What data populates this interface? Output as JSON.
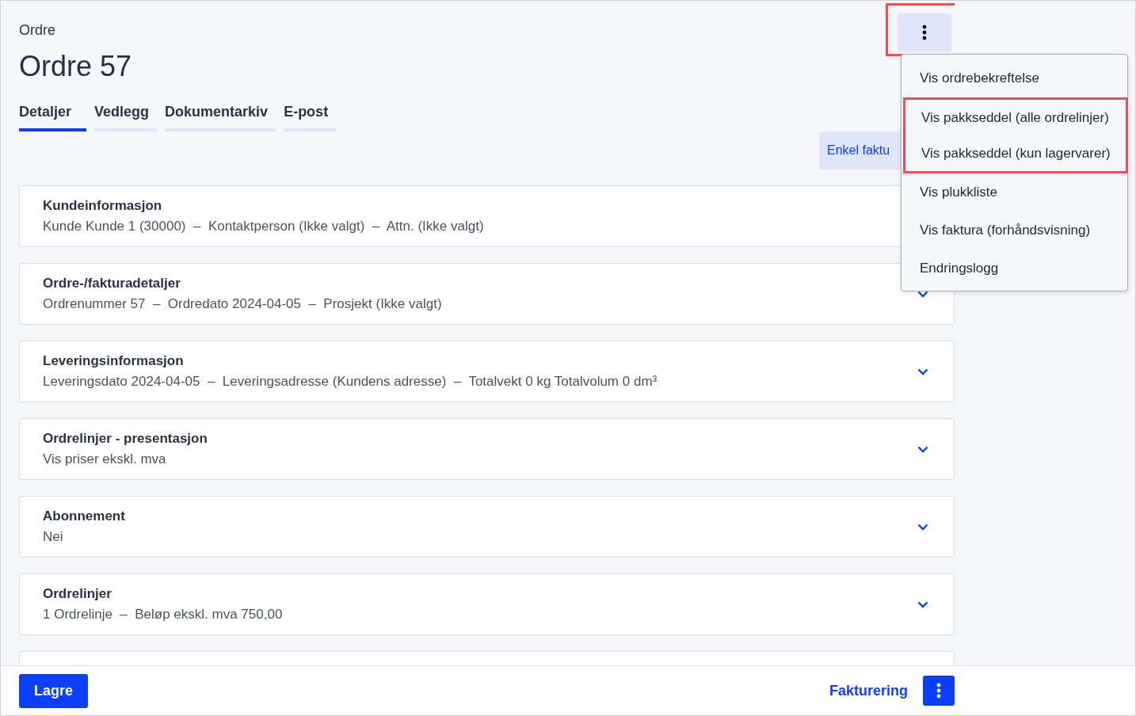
{
  "breadcrumb": "Ordre",
  "title": "Ordre 57",
  "tabs": [
    {
      "label": "Detaljer",
      "selected": true
    },
    {
      "label": "Vedlegg",
      "selected": false
    },
    {
      "label": "Dokumentarkiv",
      "selected": false
    },
    {
      "label": "E-post",
      "selected": false
    }
  ],
  "more_button": {
    "highlighted": true
  },
  "action_button": "Enkel faktu",
  "menu": [
    {
      "label": "Vis ordrebekreftelse",
      "highlighted": false
    },
    {
      "label": "Vis pakkseddel (alle ordrelinjer)",
      "highlighted": true
    },
    {
      "label": "Vis pakkseddel (kun lagervarer)",
      "highlighted": true
    },
    {
      "label": "Vis plukkliste",
      "highlighted": false
    },
    {
      "label": "Vis faktura (forhåndsvisning)",
      "highlighted": false
    },
    {
      "label": "Endringslogg",
      "highlighted": false
    }
  ],
  "sections": [
    {
      "title": "Kundeinformasjon",
      "summary": "Kunde Kunde 1 (30000)  –  Kontaktperson (Ikke valgt)  –  Attn. (Ikke valgt)",
      "chevron": false
    },
    {
      "title": "Ordre-/fakturadetaljer",
      "summary": "Ordrenummer 57  –  Ordredato 2024-04-05  –  Prosjekt (Ikke valgt)",
      "chevron": true
    },
    {
      "title": "Leveringsinformasjon",
      "summary": "Leveringsdato 2024-04-05  –  Leveringsadresse (Kundens adresse)  –  Totalvekt 0 kg Totalvolum 0 dm³",
      "chevron": true
    },
    {
      "title": "Ordrelinjer - presentasjon",
      "summary": "Vis priser ekskl. mva",
      "chevron": true
    },
    {
      "title": "Abonnement",
      "summary": "Nei",
      "chevron": true
    },
    {
      "title": "Ordrelinjer",
      "summary": "1 Ordrelinje  –  Beløp ekskl. mva 750,00",
      "chevron": true
    }
  ],
  "footer": {
    "save": "Lagre",
    "link": "Fakturering"
  }
}
